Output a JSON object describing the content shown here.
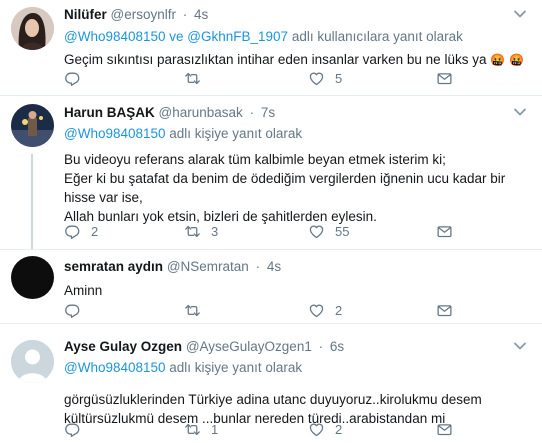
{
  "tweets": [
    {
      "name": "Nilüfer",
      "handle": "@ersoynlfr",
      "time": "4s",
      "reply_prefix": "",
      "reply_mentions": "@Who98408150 ve @GkhnFB_1907",
      "reply_suffix": " adlı kullanıcılara yanıt olarak",
      "lines": [
        "Geçim sıkıntısı  parasızlıktan intihar eden insanlar varken bu ne lüks ya"
      ],
      "emoji": [
        "🤬",
        "🤬"
      ],
      "replies": "",
      "retweets": "",
      "likes": "5"
    },
    {
      "name": "Harun BAŞAK",
      "handle": "@harunbasak",
      "time": "7s",
      "reply_mentions": "@Who98408150",
      "reply_suffix": " adlı kişiye yanıt olarak",
      "lines": [
        "Bu videoyu referans alarak tüm kalbimle beyan etmek isterim ki;",
        "Eğer ki bu şatafat da benim de ödediğim vergilerden iğnenin ucu kadar bir",
        "hisse var ise,",
        "Allah bunları yok etsin, bizleri de şahitlerden eylesin."
      ],
      "replies": "2",
      "retweets": "3",
      "likes": "55"
    },
    {
      "name": "semratan aydın",
      "handle": "@NSemratan",
      "time": "4s",
      "lines": [
        "Aminn"
      ],
      "replies": "",
      "retweets": "",
      "likes": "2"
    },
    {
      "name": "Ayse Gulay Ozgen",
      "handle": "@AyseGulayOzgen1",
      "time": "6s",
      "reply_mentions": "@Who98408150",
      "reply_suffix": " adlı kişiye yanıt olarak",
      "lines": [
        "görgüsüzluklerinden Türkiye adina utanc duyuyoruz..kirolukmu desem",
        "kültürsüzlukmü desem ...bunlar nereden türedi..arabistandan mi"
      ],
      "replies": "",
      "retweets": "1",
      "likes": "2"
    }
  ],
  "dot": "·",
  "icons": {
    "reply": "reply-icon",
    "retweet": "retweet-icon",
    "like": "heart-icon",
    "dm": "envelope-icon",
    "more": "chevron-down-icon"
  },
  "colors": {
    "text": "#14171a",
    "secondary": "#657786",
    "link": "#1b95e0",
    "divider": "#e6ecf0",
    "thread_line": "#ccd6dd"
  }
}
